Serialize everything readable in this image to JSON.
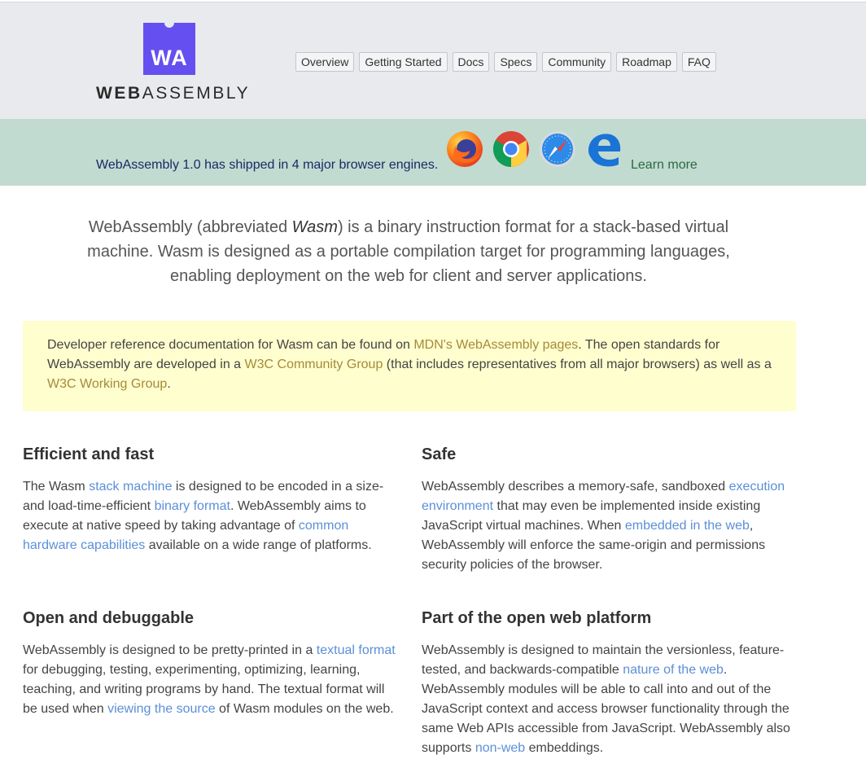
{
  "logo": {
    "letters": "WA",
    "word_bold": "WEB",
    "word_rest": "ASSEMBLY"
  },
  "nav": {
    "items": [
      {
        "label": "Overview"
      },
      {
        "label": "Getting Started"
      },
      {
        "label": "Docs"
      },
      {
        "label": "Specs"
      },
      {
        "label": "Community"
      },
      {
        "label": "Roadmap"
      },
      {
        "label": "FAQ"
      }
    ]
  },
  "banner": {
    "text": "WebAssembly 1.0 has shipped in 4 major browser engines.",
    "browsers": [
      "firefox-icon",
      "chrome-icon",
      "safari-icon",
      "edge-icon"
    ],
    "learn_more": "Learn more"
  },
  "intro": {
    "before": "WebAssembly (abbreviated ",
    "em": "Wasm",
    "after": ") is a binary instruction format for a stack-based virtual machine. Wasm is designed as a portable compilation target for programming languages, enabling deployment on the web for client and server applications."
  },
  "note": {
    "t1": "Developer reference documentation for Wasm can be found on ",
    "link1": "MDN's WebAssembly pages",
    "t2": ". The open standards for WebAssembly are developed in a ",
    "link2": "W3C Community Group",
    "t3": " (that includes representatives from all major browsers) as well as a ",
    "link3": "W3C Working Group",
    "t4": "."
  },
  "features": {
    "efficient": {
      "title": "Efficient and fast",
      "t1": "The Wasm ",
      "l1": "stack machine",
      "t2": " is designed to be encoded in a size- and load-time-efficient ",
      "l2": "binary format",
      "t3": ". WebAssembly aims to execute at native speed by taking advantage of ",
      "l3": "common hardware capabilities",
      "t4": " available on a wide range of platforms."
    },
    "safe": {
      "title": "Safe",
      "t1": "WebAssembly describes a memory-safe, sandboxed ",
      "l1": "execution environment",
      "t2": " that may even be implemented inside existing JavaScript virtual machines. When ",
      "l2": "embedded in the web",
      "t3": ", WebAssembly will enforce the same-origin and permissions security policies of the browser."
    },
    "open": {
      "title": "Open and debuggable",
      "t1": "WebAssembly is designed to be pretty-printed in a ",
      "l1": "textual format",
      "t2": " for debugging, testing, experimenting, optimizing, learning, teaching, and writing programs by hand. The textual format will be used when ",
      "l2": "viewing the source",
      "t3": " of Wasm modules on the web."
    },
    "platform": {
      "title": "Part of the open web platform",
      "t1": "WebAssembly is designed to maintain the versionless, feature-tested, and backwards-compatible ",
      "l1": "nature of the web",
      "t2": ". WebAssembly modules will be able to call into and out of the JavaScript context and access browser functionality through the same Web APIs accessible from JavaScript. WebAssembly also supports ",
      "l2": "non-web",
      "t3": " embeddings."
    }
  },
  "colors": {
    "accent": "#654ff0",
    "link": "#5b8fd8",
    "banner_bg": "#c1dbd0",
    "note_bg": "#fefece"
  }
}
